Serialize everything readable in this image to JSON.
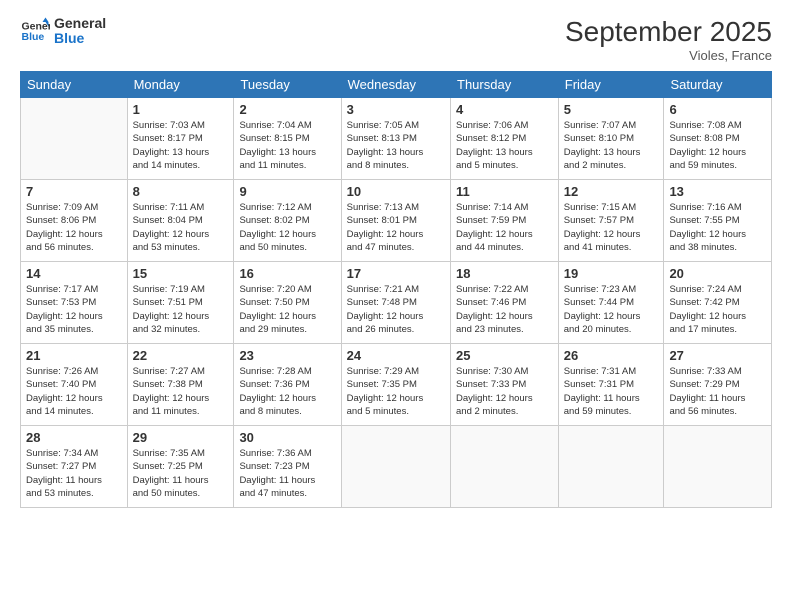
{
  "logo": {
    "line1": "General",
    "line2": "Blue"
  },
  "title": "September 2025",
  "location": "Violes, France",
  "days_of_week": [
    "Sunday",
    "Monday",
    "Tuesday",
    "Wednesday",
    "Thursday",
    "Friday",
    "Saturday"
  ],
  "weeks": [
    [
      {
        "day": "",
        "info": ""
      },
      {
        "day": "1",
        "info": "Sunrise: 7:03 AM\nSunset: 8:17 PM\nDaylight: 13 hours\nand 14 minutes."
      },
      {
        "day": "2",
        "info": "Sunrise: 7:04 AM\nSunset: 8:15 PM\nDaylight: 13 hours\nand 11 minutes."
      },
      {
        "day": "3",
        "info": "Sunrise: 7:05 AM\nSunset: 8:13 PM\nDaylight: 13 hours\nand 8 minutes."
      },
      {
        "day": "4",
        "info": "Sunrise: 7:06 AM\nSunset: 8:12 PM\nDaylight: 13 hours\nand 5 minutes."
      },
      {
        "day": "5",
        "info": "Sunrise: 7:07 AM\nSunset: 8:10 PM\nDaylight: 13 hours\nand 2 minutes."
      },
      {
        "day": "6",
        "info": "Sunrise: 7:08 AM\nSunset: 8:08 PM\nDaylight: 12 hours\nand 59 minutes."
      }
    ],
    [
      {
        "day": "7",
        "info": "Sunrise: 7:09 AM\nSunset: 8:06 PM\nDaylight: 12 hours\nand 56 minutes."
      },
      {
        "day": "8",
        "info": "Sunrise: 7:11 AM\nSunset: 8:04 PM\nDaylight: 12 hours\nand 53 minutes."
      },
      {
        "day": "9",
        "info": "Sunrise: 7:12 AM\nSunset: 8:02 PM\nDaylight: 12 hours\nand 50 minutes."
      },
      {
        "day": "10",
        "info": "Sunrise: 7:13 AM\nSunset: 8:01 PM\nDaylight: 12 hours\nand 47 minutes."
      },
      {
        "day": "11",
        "info": "Sunrise: 7:14 AM\nSunset: 7:59 PM\nDaylight: 12 hours\nand 44 minutes."
      },
      {
        "day": "12",
        "info": "Sunrise: 7:15 AM\nSunset: 7:57 PM\nDaylight: 12 hours\nand 41 minutes."
      },
      {
        "day": "13",
        "info": "Sunrise: 7:16 AM\nSunset: 7:55 PM\nDaylight: 12 hours\nand 38 minutes."
      }
    ],
    [
      {
        "day": "14",
        "info": "Sunrise: 7:17 AM\nSunset: 7:53 PM\nDaylight: 12 hours\nand 35 minutes."
      },
      {
        "day": "15",
        "info": "Sunrise: 7:19 AM\nSunset: 7:51 PM\nDaylight: 12 hours\nand 32 minutes."
      },
      {
        "day": "16",
        "info": "Sunrise: 7:20 AM\nSunset: 7:50 PM\nDaylight: 12 hours\nand 29 minutes."
      },
      {
        "day": "17",
        "info": "Sunrise: 7:21 AM\nSunset: 7:48 PM\nDaylight: 12 hours\nand 26 minutes."
      },
      {
        "day": "18",
        "info": "Sunrise: 7:22 AM\nSunset: 7:46 PM\nDaylight: 12 hours\nand 23 minutes."
      },
      {
        "day": "19",
        "info": "Sunrise: 7:23 AM\nSunset: 7:44 PM\nDaylight: 12 hours\nand 20 minutes."
      },
      {
        "day": "20",
        "info": "Sunrise: 7:24 AM\nSunset: 7:42 PM\nDaylight: 12 hours\nand 17 minutes."
      }
    ],
    [
      {
        "day": "21",
        "info": "Sunrise: 7:26 AM\nSunset: 7:40 PM\nDaylight: 12 hours\nand 14 minutes."
      },
      {
        "day": "22",
        "info": "Sunrise: 7:27 AM\nSunset: 7:38 PM\nDaylight: 12 hours\nand 11 minutes."
      },
      {
        "day": "23",
        "info": "Sunrise: 7:28 AM\nSunset: 7:36 PM\nDaylight: 12 hours\nand 8 minutes."
      },
      {
        "day": "24",
        "info": "Sunrise: 7:29 AM\nSunset: 7:35 PM\nDaylight: 12 hours\nand 5 minutes."
      },
      {
        "day": "25",
        "info": "Sunrise: 7:30 AM\nSunset: 7:33 PM\nDaylight: 12 hours\nand 2 minutes."
      },
      {
        "day": "26",
        "info": "Sunrise: 7:31 AM\nSunset: 7:31 PM\nDaylight: 11 hours\nand 59 minutes."
      },
      {
        "day": "27",
        "info": "Sunrise: 7:33 AM\nSunset: 7:29 PM\nDaylight: 11 hours\nand 56 minutes."
      }
    ],
    [
      {
        "day": "28",
        "info": "Sunrise: 7:34 AM\nSunset: 7:27 PM\nDaylight: 11 hours\nand 53 minutes."
      },
      {
        "day": "29",
        "info": "Sunrise: 7:35 AM\nSunset: 7:25 PM\nDaylight: 11 hours\nand 50 minutes."
      },
      {
        "day": "30",
        "info": "Sunrise: 7:36 AM\nSunset: 7:23 PM\nDaylight: 11 hours\nand 47 minutes."
      },
      {
        "day": "",
        "info": ""
      },
      {
        "day": "",
        "info": ""
      },
      {
        "day": "",
        "info": ""
      },
      {
        "day": "",
        "info": ""
      }
    ]
  ]
}
